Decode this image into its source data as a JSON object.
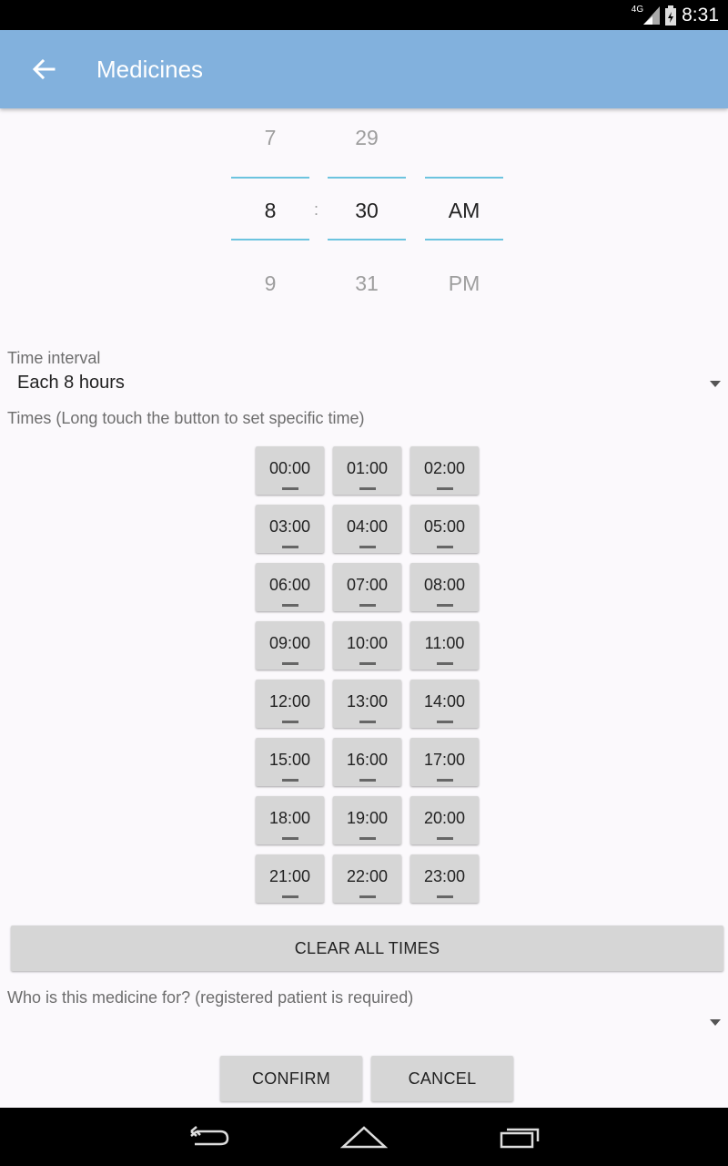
{
  "status_bar": {
    "network": "4G",
    "time": "8:31"
  },
  "app_bar": {
    "title": "Medicines",
    "back_icon": "arrow-back-icon"
  },
  "time_picker": {
    "hour": {
      "prev": "7",
      "selected": "8",
      "next": "9"
    },
    "separator": ":",
    "minute": {
      "prev": "29",
      "selected": "30",
      "next": "31"
    },
    "ampm": {
      "prev": "",
      "selected": "AM",
      "next": "PM"
    },
    "accent_color": "#6cc4df"
  },
  "interval": {
    "label": "Time interval",
    "value": "Each 8 hours"
  },
  "times": {
    "label": "Times (Long touch the button to set specific time)",
    "buttons": [
      "00:00",
      "01:00",
      "02:00",
      "03:00",
      "04:00",
      "05:00",
      "06:00",
      "07:00",
      "08:00",
      "09:00",
      "10:00",
      "11:00",
      "12:00",
      "13:00",
      "14:00",
      "15:00",
      "16:00",
      "17:00",
      "18:00",
      "19:00",
      "20:00",
      "21:00",
      "22:00",
      "23:00"
    ]
  },
  "clear_label": "CLEAR ALL TIMES",
  "patient": {
    "label": "Who is this medicine for? (registered patient is required)",
    "value": ""
  },
  "actions": {
    "confirm": "CONFIRM",
    "cancel": "CANCEL"
  },
  "colors": {
    "app_bar": "#82b1dd",
    "button_bg": "#d6d6d6"
  }
}
